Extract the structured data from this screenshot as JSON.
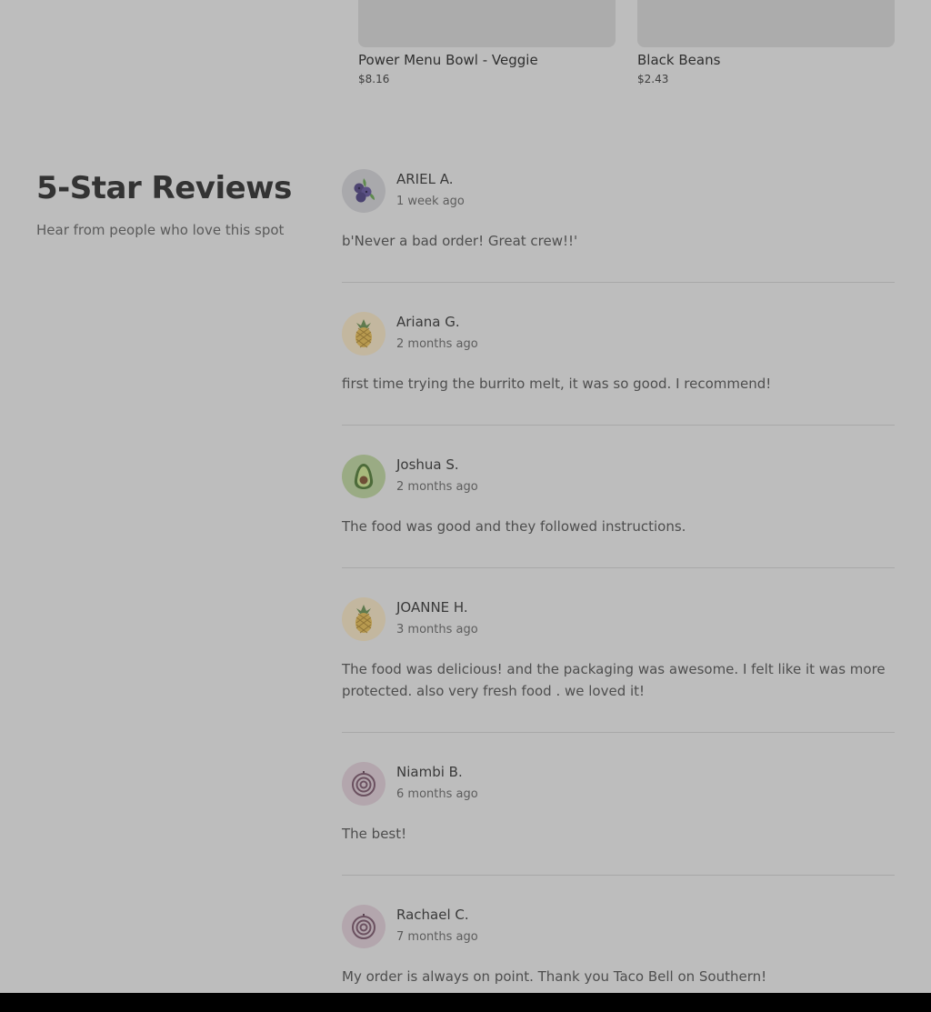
{
  "products": [
    {
      "name": "Power Menu Bowl - Veggie",
      "price": "$8.16"
    },
    {
      "name": "Black Beans",
      "price": "$2.43"
    }
  ],
  "reviews_section": {
    "title": "5-Star Reviews",
    "subtitle": "Hear from people who love this spot"
  },
  "reviews": [
    {
      "name": "ARIEL A.",
      "date": "1 week ago",
      "text": "b'Never a bad order! Great crew!!'",
      "avatar": "blueberry-icon"
    },
    {
      "name": "Ariana G.",
      "date": "2 months ago",
      "text": "first time trying the burrito melt, it was so good. I recommend!",
      "avatar": "pineapple-icon"
    },
    {
      "name": "Joshua S.",
      "date": "2 months ago",
      "text": "The food was good and they followed instructions.",
      "avatar": "avocado-icon"
    },
    {
      "name": "JOANNE H.",
      "date": "3 months ago",
      "text": "The food was delicious! and the packaging was awesome. I felt like it was more protected. also very fresh food . we loved it!",
      "avatar": "pineapple-icon"
    },
    {
      "name": "Niambi B.",
      "date": "6 months ago",
      "text": "The best!",
      "avatar": "onion-icon"
    },
    {
      "name": "Rachael C.",
      "date": "7 months ago",
      "text": "My order is always on point. Thank you Taco Bell on Southern!",
      "avatar": "onion-icon"
    }
  ],
  "colors": {
    "overlay_background": "#bdbdbd",
    "blueberry_bg": "#a9a9ac",
    "pineapple_bg": "#c3b79f",
    "avocado_bg": "#9aab84",
    "onion_bg": "#b3a6ad"
  }
}
